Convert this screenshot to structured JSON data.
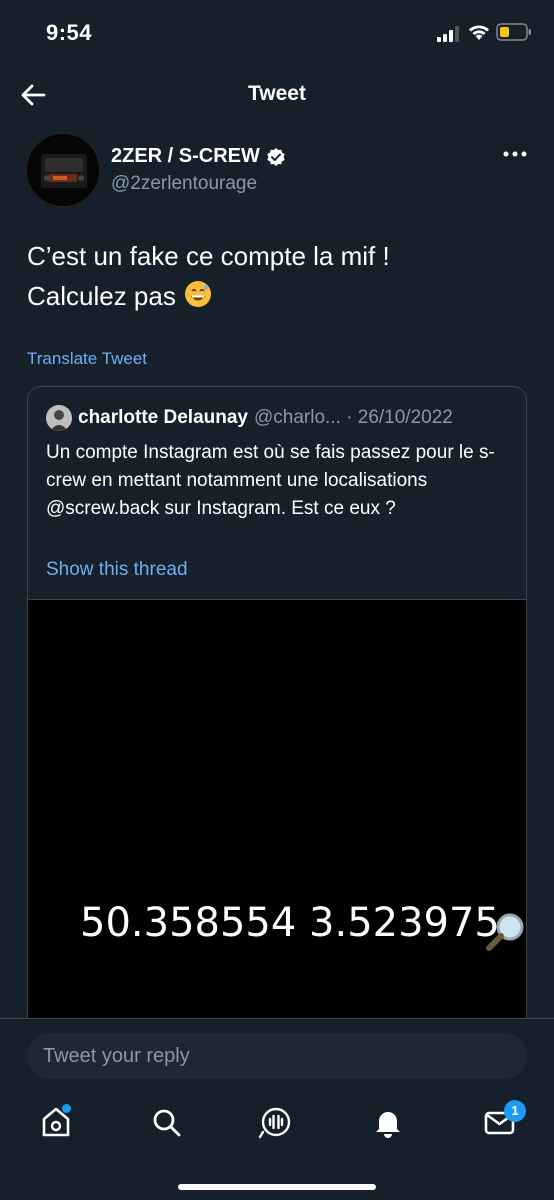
{
  "status_bar": {
    "time": "9:54"
  },
  "header": {
    "title": "Tweet"
  },
  "tweet": {
    "author_name": "2ZER / S-CREW",
    "author_handle": "@2zerlentourage",
    "text_line1": "C’est un fake ce compte la mif !",
    "text_line2": "Calculez pas",
    "translate_label": "Translate Tweet"
  },
  "quote": {
    "author_name": "charlotte Delaunay",
    "author_handle": "@charlo... · 26/10/2022",
    "text": "Un compte Instagram est où se fais passez pour le s-crew en mettant notamment une localisations @screw.back sur Instagram. Est ce eux ?",
    "show_thread_label": "Show this thread",
    "media_caption": "50.358554 3.523975"
  },
  "reply": {
    "placeholder": "Tweet your reply"
  },
  "tabs": {
    "notifications_badge": "1"
  },
  "colors": {
    "background": "#15202b",
    "accent": "#1d9bf0",
    "link": "#6ab0f3",
    "muted": "#8b98a5",
    "border": "#38444d"
  }
}
